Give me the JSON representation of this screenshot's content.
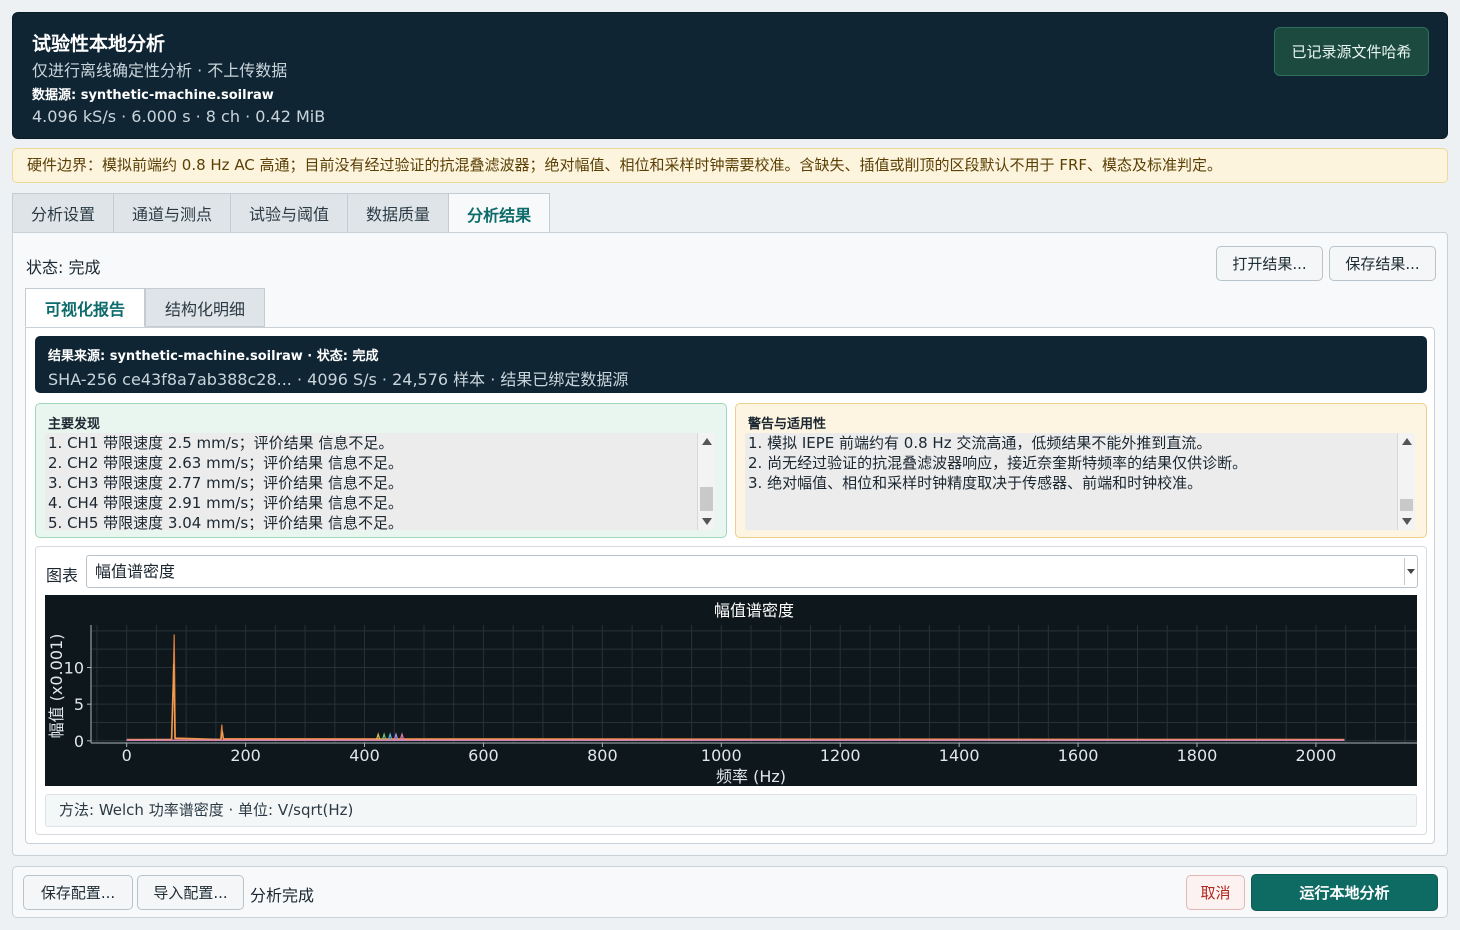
{
  "header": {
    "title": "试验性本地分析",
    "subtitle": "仅进行离线确定性分析 · 不上传数据",
    "source": "数据源: synthetic-machine.soilraw",
    "stats": "4.096 kS/s · 6.000 s · 8 ch · 0.42 MiB",
    "hash_badge": "已记录源文件哈希"
  },
  "warning_banner": "硬件边界：模拟前端约 0.8 Hz AC 高通；目前没有经过验证的抗混叠滤波器；绝对幅值、相位和采样时钟需要校准。含缺失、插值或削顶的区段默认不用于 FRF、模态及标准判定。",
  "main_tabs": [
    "分析设置",
    "通道与测点",
    "试验与阈值",
    "数据质量",
    "分析结果"
  ],
  "active_main_tab": "分析结果",
  "panel": {
    "status": "状态: 完成",
    "open_button": "打开结果...",
    "save_button": "保存结果..."
  },
  "sub_tabs": [
    "可视化报告",
    "结构化明细"
  ],
  "result_bar": {
    "line1": "结果来源: synthetic-machine.soilraw · 状态: 完成",
    "line2": "SHA-256 ce43f8a7ab388c28... · 4096 S/s · 24,576 样本 · 结果已绑定数据源"
  },
  "findings": {
    "title": "主要发现",
    "items": [
      "1. CH1 带限速度 2.5 mm/s；评价结果 信息不足。",
      "2. CH2 带限速度 2.63 mm/s；评价结果 信息不足。",
      "3. CH3 带限速度 2.77 mm/s；评价结果 信息不足。",
      "4. CH4 带限速度 2.91 mm/s；评价结果 信息不足。",
      "5. CH5 带限速度 3.04 mm/s；评价结果 信息不足。"
    ]
  },
  "warnings": {
    "title": "警告与适用性",
    "items": [
      "1. 模拟 IEPE 前端约有 0.8 Hz 交流高通，低频结果不能外推到直流。",
      "2. 尚无经过验证的抗混叠滤波器响应，接近奈奎斯特频率的结果仅供诊断。",
      "3. 绝对幅值、相位和采样时钟精度取决于传感器、前端和时钟校准。"
    ]
  },
  "chart_section": {
    "label": "图表",
    "selected": "幅值谱密度",
    "meta": "方法: Welch 功率谱密度 · 单位: V/sqrt(Hz)"
  },
  "chart_data": {
    "type": "line",
    "title": "幅值谱密度",
    "xlabel": "频率 (Hz)",
    "ylabel": "幅值 (x0.001)",
    "xlim": [
      -60,
      2170
    ],
    "ylim": [
      -0.3,
      15.8
    ],
    "xticks": [
      0,
      200,
      400,
      600,
      800,
      1000,
      1200,
      1400,
      1600,
      1800,
      2000
    ],
    "yticks": [
      0,
      5,
      10
    ],
    "grid": true,
    "series": [
      {
        "color": "#e07b39",
        "points": [
          [
            0,
            0.2
          ],
          [
            75,
            0.2
          ],
          [
            78,
            8
          ],
          [
            80,
            14.5
          ],
          [
            82,
            0.4
          ],
          [
            158,
            0.2
          ],
          [
            160,
            2.2
          ],
          [
            162,
            0.3
          ],
          [
            2048,
            0.2
          ]
        ]
      },
      {
        "color": "#f0a050",
        "points": [
          [
            0,
            0.15
          ],
          [
            76,
            0.2
          ],
          [
            79,
            10.5
          ],
          [
            81,
            0.3
          ],
          [
            159,
            0.2
          ],
          [
            161,
            1.3
          ],
          [
            163,
            0.2
          ],
          [
            2048,
            0.15
          ]
        ]
      },
      {
        "color": "#d9c45a",
        "points": [
          [
            0,
            0.1
          ],
          [
            420,
            0.1
          ],
          [
            423,
            0.9
          ],
          [
            426,
            0.1
          ],
          [
            2048,
            0.1
          ]
        ]
      },
      {
        "color": "#6fc46f",
        "points": [
          [
            0,
            0.1
          ],
          [
            430,
            0.1
          ],
          [
            433,
            0.9
          ],
          [
            436,
            0.1
          ],
          [
            2048,
            0.1
          ]
        ]
      },
      {
        "color": "#5fb3d9",
        "points": [
          [
            0,
            0.1
          ],
          [
            440,
            0.1
          ],
          [
            443,
            0.9
          ],
          [
            446,
            0.1
          ],
          [
            2048,
            0.1
          ]
        ]
      },
      {
        "color": "#b58be0",
        "points": [
          [
            0,
            0.1
          ],
          [
            450,
            0.1
          ],
          [
            453,
            0.9
          ],
          [
            456,
            0.1
          ],
          [
            2048,
            0.1
          ]
        ]
      },
      {
        "color": "#e07bb0",
        "points": [
          [
            0,
            0.1
          ],
          [
            460,
            0.1
          ],
          [
            463,
            0.9
          ],
          [
            466,
            0.1
          ],
          [
            2048,
            0.1
          ]
        ]
      }
    ]
  },
  "footer": {
    "save_config": "保存配置...",
    "import_config": "导入配置...",
    "status": "分析完成",
    "cancel": "取消",
    "run": "运行本地分析"
  }
}
